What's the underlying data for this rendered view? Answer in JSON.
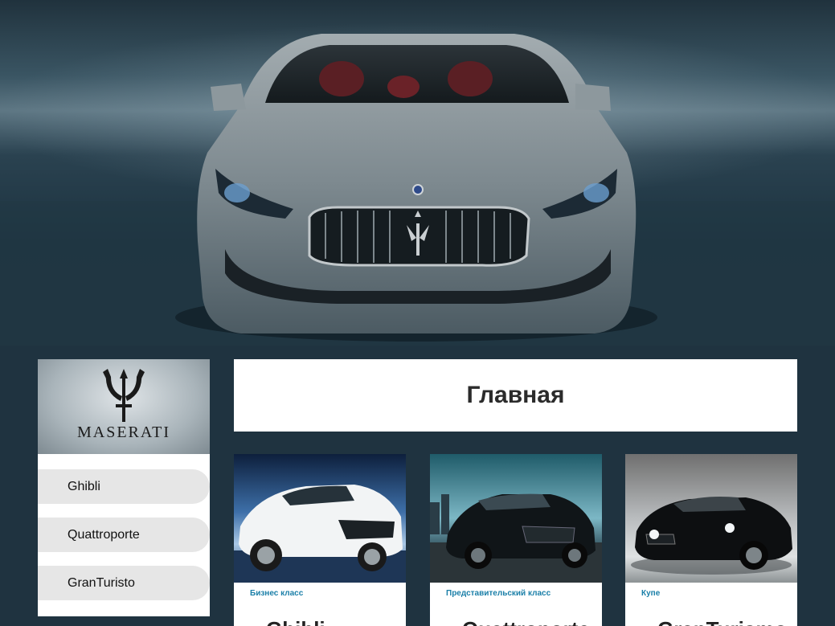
{
  "hero": {
    "image": "maserati-ghibli-front-hero"
  },
  "sidebar": {
    "logo": {
      "icon": "maserati-trident-icon",
      "text": "MASERATI"
    },
    "items": [
      {
        "label": "Ghibli"
      },
      {
        "label": "Quattroporte"
      },
      {
        "label": "GranTuristo"
      }
    ]
  },
  "main": {
    "title": "Главная",
    "cards": [
      {
        "category": "Бизнес класс",
        "title": "Ghibli",
        "image": "white-ghibli-photo"
      },
      {
        "category": "Представительский класс",
        "title": "Quattroporte",
        "image": "black-quattroporte-photo"
      },
      {
        "category": "Купе",
        "title": "GranTurismo",
        "image": "black-granturismo-photo"
      }
    ]
  },
  "colors": {
    "page_bg": "#1f3340",
    "card_bg": "#ffffff",
    "nav_item_bg": "#e6e6e6",
    "category_text": "#1a7fa8"
  }
}
